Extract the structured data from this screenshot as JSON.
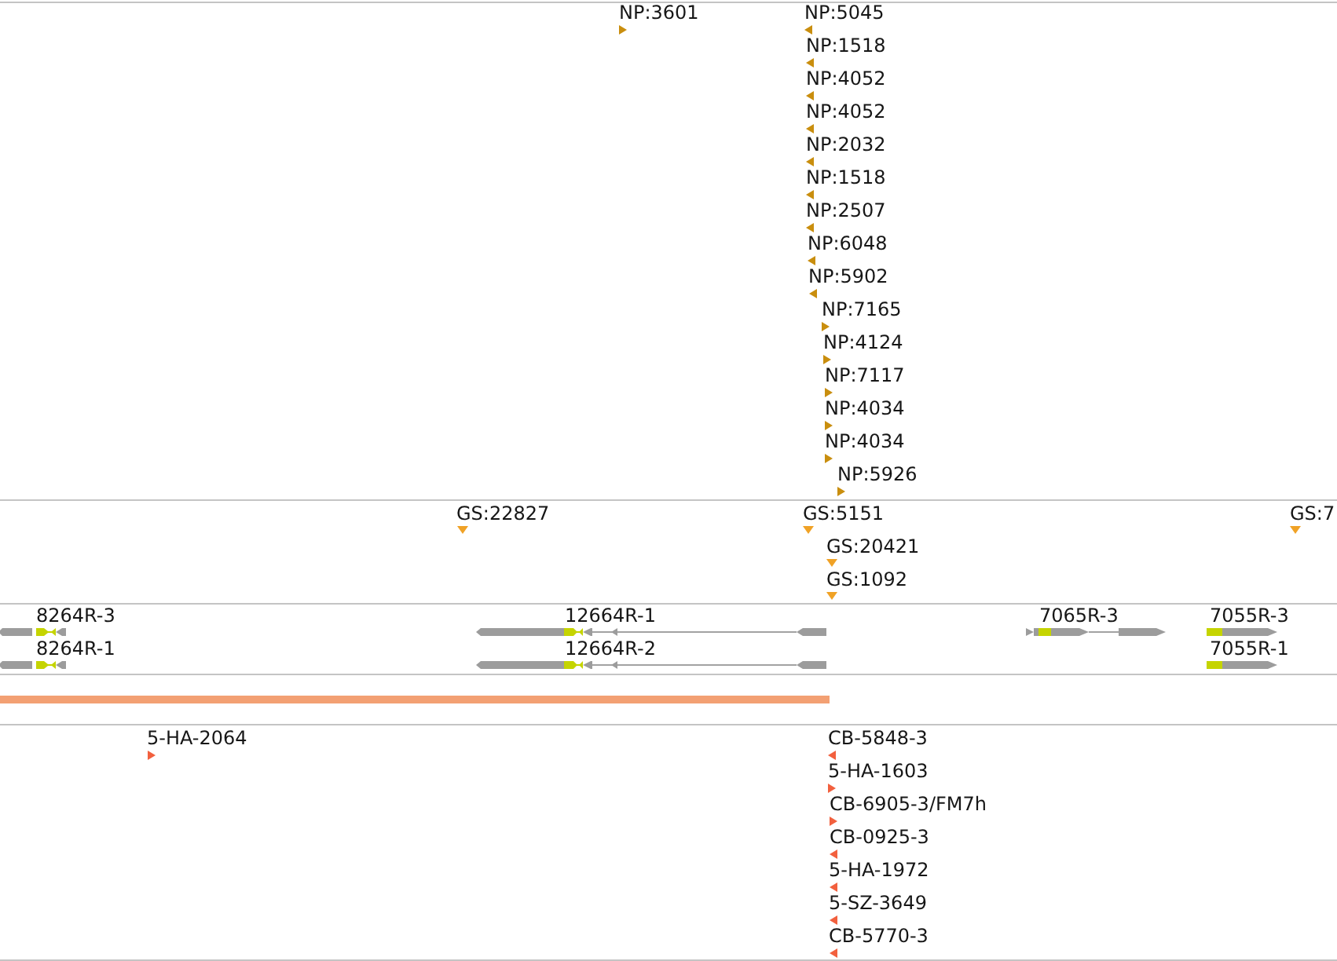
{
  "tracks": [
    {
      "kind": "insertions",
      "features": [
        {
          "label": "NP:3601",
          "reverse": false
        },
        {
          "label": "NP:5045",
          "reverse": true
        },
        {
          "label": "NP:1518",
          "reverse": true
        },
        {
          "label": "NP:4052",
          "reverse": true
        },
        {
          "label": "NP:4052",
          "reverse": true
        },
        {
          "label": "NP:2032",
          "reverse": true
        },
        {
          "label": "NP:1518",
          "reverse": true
        },
        {
          "label": "NP:2507",
          "reverse": true
        },
        {
          "label": "NP:6048",
          "reverse": true
        },
        {
          "label": "NP:5902",
          "reverse": true
        },
        {
          "label": "NP:7165",
          "reverse": false
        },
        {
          "label": "NP:4124",
          "reverse": false
        },
        {
          "label": "NP:7117",
          "reverse": false
        },
        {
          "label": "NP:4034",
          "reverse": false
        },
        {
          "label": "NP:4034",
          "reverse": false
        },
        {
          "label": "NP:5926",
          "reverse": false
        }
      ]
    },
    {
      "kind": "insertions",
      "features": [
        {
          "label": "GS:22827"
        },
        {
          "label": "GS:5151"
        },
        {
          "label": "GS:20421"
        },
        {
          "label": "GS:1092"
        },
        {
          "label": "GS:7"
        }
      ]
    },
    {
      "kind": "transcripts",
      "features": [
        {
          "label": "8264R-3",
          "reverse": true
        },
        {
          "label": "8264R-1",
          "reverse": true
        },
        {
          "label": "12664R-1",
          "reverse": true
        },
        {
          "label": "12664R-2",
          "reverse": true
        },
        {
          "label": "7065R-3",
          "reverse": false
        },
        {
          "label": "7055R-3",
          "reverse": false
        },
        {
          "label": "7055R-1",
          "reverse": false
        }
      ]
    },
    {
      "kind": "bar"
    },
    {
      "kind": "insertions",
      "features": [
        {
          "label": "5-HA-2064",
          "reverse": false
        },
        {
          "label": "CB-5848-3",
          "reverse": true
        },
        {
          "label": "5-HA-1603",
          "reverse": false
        },
        {
          "label": "CB-6905-3/FM7h",
          "reverse": false
        },
        {
          "label": "CB-0925-3",
          "reverse": true
        },
        {
          "label": "5-HA-1972",
          "reverse": true
        },
        {
          "label": "5-SZ-3649",
          "reverse": true
        },
        {
          "label": "CB-5770-3",
          "reverse": true
        }
      ]
    }
  ]
}
